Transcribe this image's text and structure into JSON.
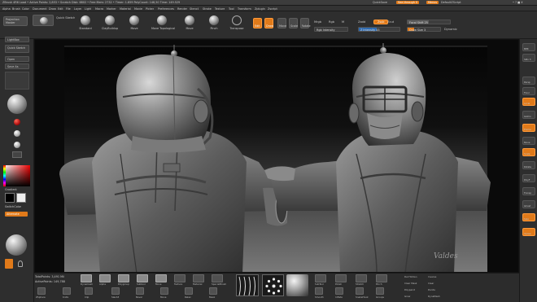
{
  "titlebar": {
    "app": "ZBrush 4R6",
    "left_text": "ZBrush 4R6  Load  • Active Points: 2,853  • Scratch Disk: 6802  • Free Mem: 2732  • Timer: 1.859  PolyCount: 148,50  Time: 149.529",
    "quicksave": "QuickSave",
    "seethrough": "See-through 0",
    "menus": "Menus",
    "default_script": "DefaultZScript",
    "window_controls": "• ? ■ X"
  },
  "menubar": [
    "Alpha",
    "Brush",
    "Color",
    "Document",
    "Draw",
    "Edit",
    "File",
    "Layer",
    "Light",
    "Macro",
    "Marker",
    "Material",
    "Movie",
    "Picker",
    "Preferences",
    "Render",
    "Stencil",
    "Stroke",
    "Texture",
    "Tool",
    "Transform",
    "Zplugin",
    "Zscript"
  ],
  "shelf": {
    "projection_master": "Projection Master",
    "lightbox": "LightBox",
    "quick_sketch": "Quick Sketch",
    "edit": "Edit",
    "draw": "Draw",
    "move": "Move",
    "scale": "Scale",
    "rotate": "Rotate",
    "brushes": [
      "Standard",
      "ClayBuildup",
      "Move",
      "Move Topological",
      "Move",
      "Pinch",
      "Transpose"
    ],
    "mrgb": "Mrgb",
    "rgb": "Rgb",
    "m": "M",
    "zadd": "Zadd",
    "zsub": "Zsub",
    "zcut": "Zcut",
    "rgb_intensity": "Rgb Intensity",
    "z_intensity": "Z Intensity 43",
    "focal_shift": "Focal Shift 25",
    "draw_size": "Draw Size 3",
    "dynamic": "Dynamic",
    "active_points": "ActivePoints: 1,493 / PolyCount"
  },
  "lefttray": {
    "lightbox": "LightBox",
    "quick_sketch": "Quick Sketch",
    "open": "Open",
    "save_as": "Save As",
    "material_label": "Gradient",
    "switch_color": "SwitchColor",
    "alternate": "Alternate",
    "gradient": "Gradient"
  },
  "righttray": [
    "BPR",
    "SPix 3",
    "Persp",
    "Floor",
    "Local",
    "Gizmo",
    "Frame",
    "Move",
    "Scale",
    "Rotate",
    "PolyF",
    "Transp",
    "Ghost",
    "Solo",
    "Xpose"
  ],
  "bottom": {
    "total_points": "TotalPoints: 3,491 Mil",
    "active_points": "ActivePoints: 149,788",
    "items_row1": [
      "Dynamesh",
      "Alpha",
      "Polygroup",
      "Subtool",
      "Move",
      "Texture",
      "Material",
      "SpecialBrush",
      "Dots",
      "SubTool",
      "Polish",
      "Stretch",
      "Pinch",
      "Curve",
      "Flatten",
      "Del Hidden",
      "Clear Mask",
      "Divide"
    ],
    "items_row2": [
      "ZSphere",
      "Knife",
      "Clip",
      "Slash3",
      "Bevel",
      "Move",
      "Relax",
      "Mask",
      "Smooth",
      "Inflate",
      "SnakeHook",
      "Groups",
      "Polypaint",
      "Draw Mode",
      "Mask"
    ],
    "del_hidden": "Del Hidden",
    "grow": "Grow",
    "inverse": "Inverse",
    "clear": "Clear",
    "dyna": "DynaMesh"
  },
  "colors": {
    "accent": "#e07a1a",
    "panel": "#2e2e2e",
    "canvas": "#0a0a0a"
  }
}
